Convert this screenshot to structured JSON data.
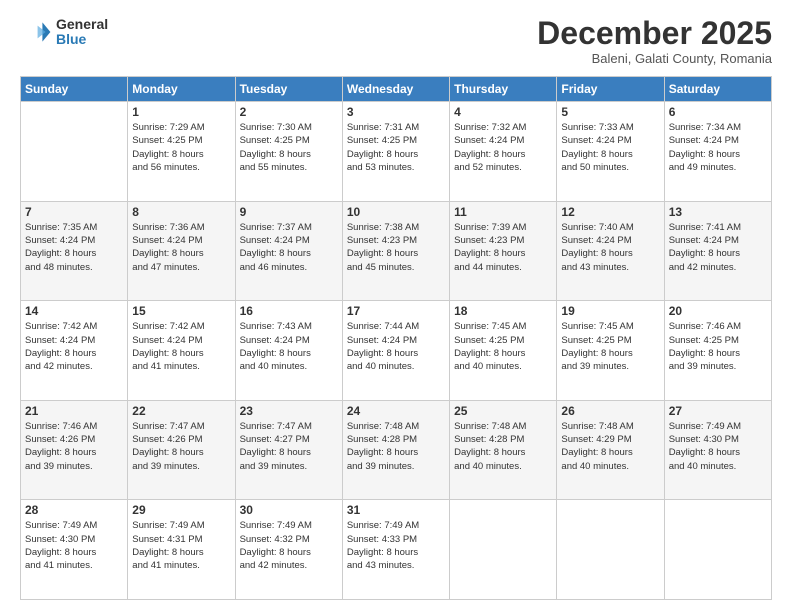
{
  "logo": {
    "general": "General",
    "blue": "Blue"
  },
  "header": {
    "month": "December 2025",
    "location": "Baleni, Galati County, Romania"
  },
  "weekdays": [
    "Sunday",
    "Monday",
    "Tuesday",
    "Wednesday",
    "Thursday",
    "Friday",
    "Saturday"
  ],
  "weeks": [
    [
      {
        "day": "",
        "info": ""
      },
      {
        "day": "1",
        "info": "Sunrise: 7:29 AM\nSunset: 4:25 PM\nDaylight: 8 hours\nand 56 minutes."
      },
      {
        "day": "2",
        "info": "Sunrise: 7:30 AM\nSunset: 4:25 PM\nDaylight: 8 hours\nand 55 minutes."
      },
      {
        "day": "3",
        "info": "Sunrise: 7:31 AM\nSunset: 4:25 PM\nDaylight: 8 hours\nand 53 minutes."
      },
      {
        "day": "4",
        "info": "Sunrise: 7:32 AM\nSunset: 4:24 PM\nDaylight: 8 hours\nand 52 minutes."
      },
      {
        "day": "5",
        "info": "Sunrise: 7:33 AM\nSunset: 4:24 PM\nDaylight: 8 hours\nand 50 minutes."
      },
      {
        "day": "6",
        "info": "Sunrise: 7:34 AM\nSunset: 4:24 PM\nDaylight: 8 hours\nand 49 minutes."
      }
    ],
    [
      {
        "day": "7",
        "info": "Sunrise: 7:35 AM\nSunset: 4:24 PM\nDaylight: 8 hours\nand 48 minutes."
      },
      {
        "day": "8",
        "info": "Sunrise: 7:36 AM\nSunset: 4:24 PM\nDaylight: 8 hours\nand 47 minutes."
      },
      {
        "day": "9",
        "info": "Sunrise: 7:37 AM\nSunset: 4:24 PM\nDaylight: 8 hours\nand 46 minutes."
      },
      {
        "day": "10",
        "info": "Sunrise: 7:38 AM\nSunset: 4:23 PM\nDaylight: 8 hours\nand 45 minutes."
      },
      {
        "day": "11",
        "info": "Sunrise: 7:39 AM\nSunset: 4:23 PM\nDaylight: 8 hours\nand 44 minutes."
      },
      {
        "day": "12",
        "info": "Sunrise: 7:40 AM\nSunset: 4:24 PM\nDaylight: 8 hours\nand 43 minutes."
      },
      {
        "day": "13",
        "info": "Sunrise: 7:41 AM\nSunset: 4:24 PM\nDaylight: 8 hours\nand 42 minutes."
      }
    ],
    [
      {
        "day": "14",
        "info": "Sunrise: 7:42 AM\nSunset: 4:24 PM\nDaylight: 8 hours\nand 42 minutes."
      },
      {
        "day": "15",
        "info": "Sunrise: 7:42 AM\nSunset: 4:24 PM\nDaylight: 8 hours\nand 41 minutes."
      },
      {
        "day": "16",
        "info": "Sunrise: 7:43 AM\nSunset: 4:24 PM\nDaylight: 8 hours\nand 40 minutes."
      },
      {
        "day": "17",
        "info": "Sunrise: 7:44 AM\nSunset: 4:24 PM\nDaylight: 8 hours\nand 40 minutes."
      },
      {
        "day": "18",
        "info": "Sunrise: 7:45 AM\nSunset: 4:25 PM\nDaylight: 8 hours\nand 40 minutes."
      },
      {
        "day": "19",
        "info": "Sunrise: 7:45 AM\nSunset: 4:25 PM\nDaylight: 8 hours\nand 39 minutes."
      },
      {
        "day": "20",
        "info": "Sunrise: 7:46 AM\nSunset: 4:25 PM\nDaylight: 8 hours\nand 39 minutes."
      }
    ],
    [
      {
        "day": "21",
        "info": "Sunrise: 7:46 AM\nSunset: 4:26 PM\nDaylight: 8 hours\nand 39 minutes."
      },
      {
        "day": "22",
        "info": "Sunrise: 7:47 AM\nSunset: 4:26 PM\nDaylight: 8 hours\nand 39 minutes."
      },
      {
        "day": "23",
        "info": "Sunrise: 7:47 AM\nSunset: 4:27 PM\nDaylight: 8 hours\nand 39 minutes."
      },
      {
        "day": "24",
        "info": "Sunrise: 7:48 AM\nSunset: 4:28 PM\nDaylight: 8 hours\nand 39 minutes."
      },
      {
        "day": "25",
        "info": "Sunrise: 7:48 AM\nSunset: 4:28 PM\nDaylight: 8 hours\nand 40 minutes."
      },
      {
        "day": "26",
        "info": "Sunrise: 7:48 AM\nSunset: 4:29 PM\nDaylight: 8 hours\nand 40 minutes."
      },
      {
        "day": "27",
        "info": "Sunrise: 7:49 AM\nSunset: 4:30 PM\nDaylight: 8 hours\nand 40 minutes."
      }
    ],
    [
      {
        "day": "28",
        "info": "Sunrise: 7:49 AM\nSunset: 4:30 PM\nDaylight: 8 hours\nand 41 minutes."
      },
      {
        "day": "29",
        "info": "Sunrise: 7:49 AM\nSunset: 4:31 PM\nDaylight: 8 hours\nand 41 minutes."
      },
      {
        "day": "30",
        "info": "Sunrise: 7:49 AM\nSunset: 4:32 PM\nDaylight: 8 hours\nand 42 minutes."
      },
      {
        "day": "31",
        "info": "Sunrise: 7:49 AM\nSunset: 4:33 PM\nDaylight: 8 hours\nand 43 minutes."
      },
      {
        "day": "",
        "info": ""
      },
      {
        "day": "",
        "info": ""
      },
      {
        "day": "",
        "info": ""
      }
    ]
  ]
}
